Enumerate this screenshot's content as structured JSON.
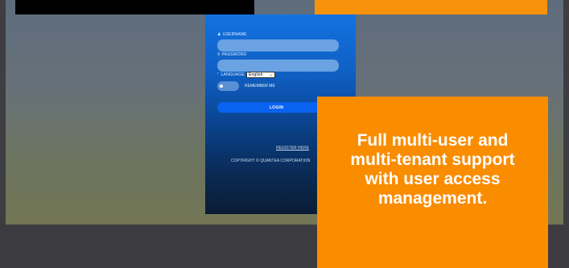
{
  "login": {
    "username_label": "USERNAME",
    "password_label": "PASSWORD",
    "language_label": "LANGUAGE",
    "language_value": "English",
    "remember_label": "REMEMBER ME",
    "login_button": "LOGIN",
    "register_link": "REGISTER HERE",
    "copyright": "COPYRIGHT © QUANTEA CORPORATION"
  },
  "callout": {
    "text": "Full multi-user and multi-tenant support with user access management."
  },
  "colors": {
    "accent": "#fa8c00",
    "panel_top": "#1372e0",
    "panel_bottom": "#0a1c33",
    "login_button": "#0a63f0"
  }
}
